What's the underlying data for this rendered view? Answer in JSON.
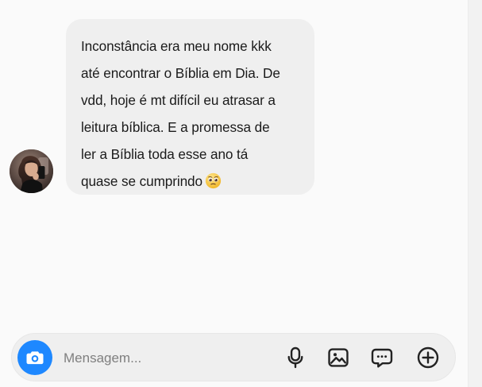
{
  "thread": {
    "message": "Inconstância era meu nome kkk\naté encontrar o Bíblia em Dia. De\nvdd, hoje é mt difícil eu atrasar a\nleitura bíblica. E a promessa de\nler a Bíblia toda esse ano tá\nquase se cumprindo",
    "emoji": "pleading-face-icon"
  },
  "composer": {
    "placeholder": "Mensagem...",
    "value": ""
  },
  "icons": {
    "camera": "camera-icon",
    "microphone": "microphone-icon",
    "gallery": "image-icon",
    "chat": "chat-bubble-icon",
    "add": "plus-circle-icon"
  },
  "colors": {
    "accent": "#1e88ff",
    "bubble": "#efefef",
    "background": "#fafafa"
  }
}
